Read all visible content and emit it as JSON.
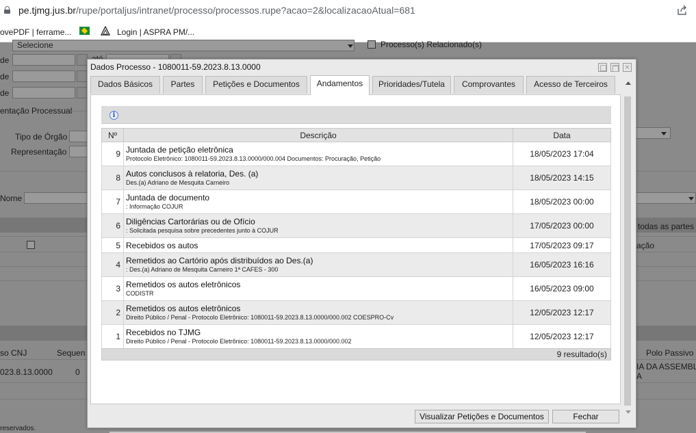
{
  "browser": {
    "url_host": "pe.tjmg.jus.br",
    "url_path": "/rupe/portaljus/intranet/processo/processos.rupe?acao=2&localizacaoAtual=681",
    "bookmarks": [
      "ovePDF | ferrame...",
      "Login | ASPRA PM/..."
    ]
  },
  "background": {
    "labels": {
      "de1": "de",
      "de2": "de",
      "de3": "de",
      "ate": "até",
      "select": "Selecione",
      "relacionados": "Processo(s) Relacionado(s)",
      "section": "entação Processual",
      "tipo_orgao": "Tipo de Órgão",
      "representacao": "Representação",
      "nome": "Nome",
      "todas_partes": "todas as partes",
      "acao": "ação",
      "col_cnj": "so CNJ",
      "col_seq": "Sequen",
      "col_polo": "Polo Passivo",
      "row_cnj": "023.8.13.0000",
      "row_seq": "0",
      "row_polo_1": "IA DA ASSEMBL",
      "row_polo_2": "A",
      "footer": "reservados."
    }
  },
  "modal": {
    "title": "Dados Processo - 1080011-59.2023.8.13.0000",
    "tabs": [
      "Dados Básicos",
      "Partes",
      "Petições e Documentos",
      "Andamentos",
      "Prioridades/Tutela",
      "Comprovantes",
      "Acesso de Terceiros"
    ],
    "active_tab": "Andamentos",
    "table": {
      "headers": {
        "num": "Nº",
        "desc": "Descrição",
        "date": "Data"
      },
      "rows": [
        {
          "num": "9",
          "title": "Juntada de petição eletrônica",
          "sub": "Protocolo Eletrônico: 1080011-59.2023.8.13.0000/000.004 Documentos: Procuração, Petição",
          "date": "18/05/2023 17:04"
        },
        {
          "num": "8",
          "title": "Autos conclusos à relatoria, Des. (a)",
          "sub": "Des.(a) Adriano de Mesquita Carneiro",
          "date": "18/05/2023 14:15"
        },
        {
          "num": "7",
          "title": "Juntada de documento",
          "sub": ": Informação COJUR",
          "date": "18/05/2023 00:00"
        },
        {
          "num": "6",
          "title": "Diligências Cartorárias ou de Ofício",
          "sub": ": Solicitada pesquisa sobre precedentes junto à COJUR",
          "date": "17/05/2023 00:00"
        },
        {
          "num": "5",
          "title": "Recebidos os autos",
          "sub": "",
          "date": "17/05/2023 09:17"
        },
        {
          "num": "4",
          "title": "Remetidos ao Cartório após distribuídos ao Des.(a)",
          "sub": ": Des.(a) Adriano de Mesquita Carneiro 1ª CAFES - 300",
          "date": "16/05/2023 16:16"
        },
        {
          "num": "3",
          "title": "Remetidos os autos eletrônicos",
          "sub": "CODISTR",
          "date": "16/05/2023 09:00"
        },
        {
          "num": "2",
          "title": "Remetidos os autos eletrônicos",
          "sub": "Direito Público / Penal - Protocolo Eletrônico: 1080011-59.2023.8.13.0000/000.002 COESPRO-Cv",
          "date": "12/05/2023 12:17"
        },
        {
          "num": "1",
          "title": "Recebidos no TJMG",
          "sub": "Direito Público / Penal - Protocolo Eletrônico: 1080011-59.2023.8.13.0000/000.002",
          "date": "12/05/2023 12:17"
        }
      ],
      "result_count": "9 resultado(s)"
    },
    "buttons": {
      "view_docs": "Visualizar Petições e Documentos",
      "close": "Fechar"
    }
  }
}
